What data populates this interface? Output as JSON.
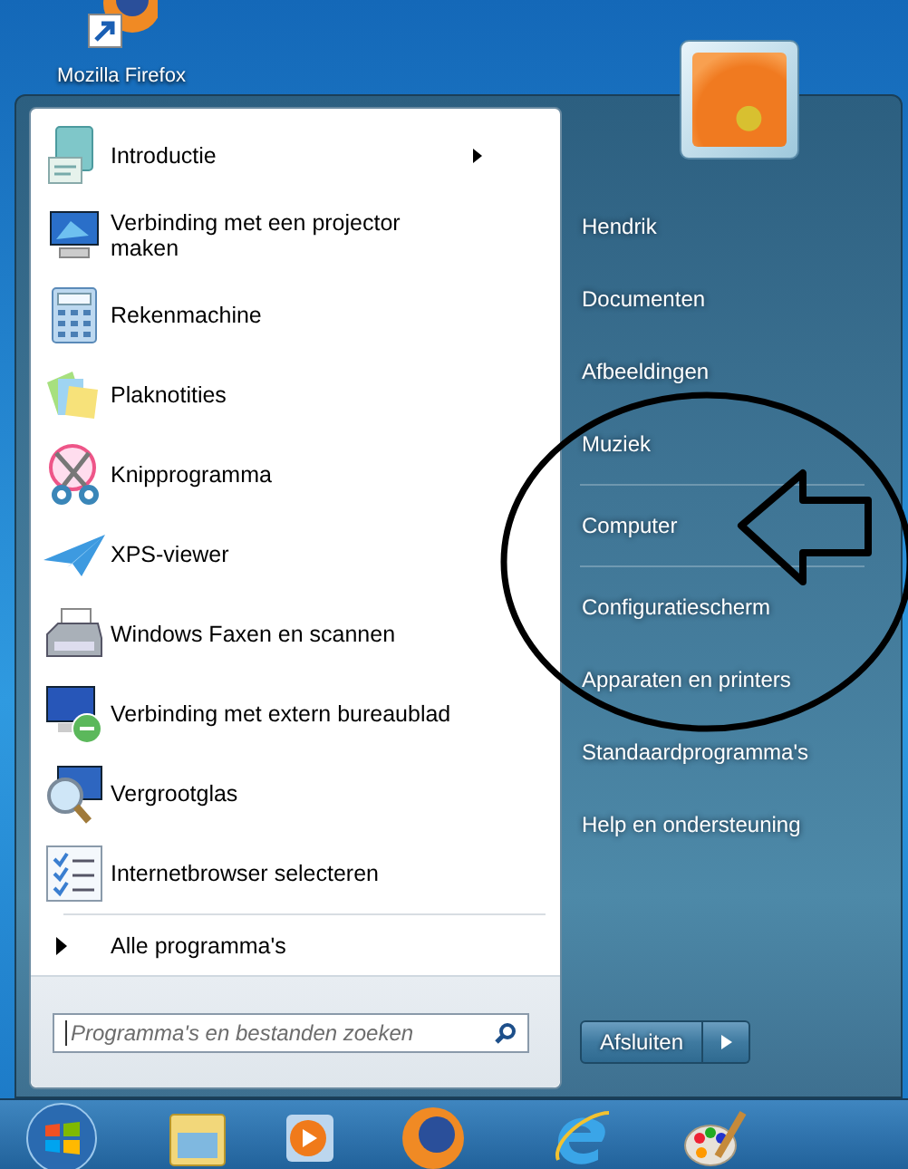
{
  "desktop_icons": [
    {
      "label": "Mozilla Firefox"
    }
  ],
  "start_menu": {
    "programs": [
      {
        "label": "Introductie",
        "submenu": true
      },
      {
        "label": "Verbinding met een projector maken",
        "submenu": false
      },
      {
        "label": "Rekenmachine",
        "submenu": false
      },
      {
        "label": "Plaknotities",
        "submenu": false
      },
      {
        "label": "Knipprogramma",
        "submenu": false
      },
      {
        "label": "XPS-viewer",
        "submenu": false
      },
      {
        "label": "Windows Faxen en scannen",
        "submenu": false
      },
      {
        "label": "Verbinding met extern bureaublad",
        "submenu": false
      },
      {
        "label": "Vergrootglas",
        "submenu": false
      },
      {
        "label": "Internetbrowser selecteren",
        "submenu": false
      }
    ],
    "all_programs": "Alle programma's",
    "search": {
      "placeholder": "Programma's en bestanden zoeken"
    },
    "places": [
      {
        "label": "Hendrik",
        "separator_before": false
      },
      {
        "label": "Documenten",
        "separator_before": false
      },
      {
        "label": "Afbeeldingen",
        "separator_before": false
      },
      {
        "label": "Muziek",
        "separator_before": false
      },
      {
        "label": "Computer",
        "separator_before": true
      },
      {
        "label": "Configuratiescherm",
        "separator_before": true
      },
      {
        "label": "Apparaten en printers",
        "separator_before": false
      },
      {
        "label": "Standaardprogramma's",
        "separator_before": false
      },
      {
        "label": "Help en ondersteuning",
        "separator_before": false
      }
    ],
    "shutdown_button": "Afsluiten"
  }
}
